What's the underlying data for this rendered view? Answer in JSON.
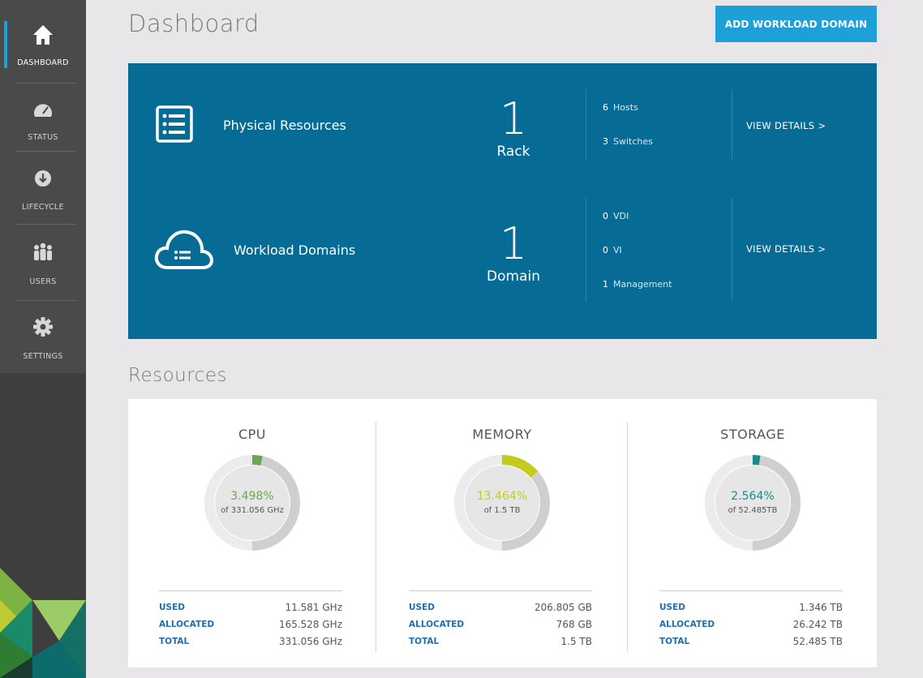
{
  "sidebar": {
    "items": [
      {
        "label": "DASHBOARD",
        "icon": "home-icon",
        "active": true
      },
      {
        "label": "STATUS",
        "icon": "gauge-icon"
      },
      {
        "label": "LIFECYCLE",
        "icon": "download-icon"
      },
      {
        "label": "USERS",
        "icon": "users-icon"
      },
      {
        "label": "SETTINGS",
        "icon": "gear-icon"
      }
    ]
  },
  "header": {
    "title": "Dashboard",
    "add_button": "ADD WORKLOAD DOMAIN"
  },
  "physical": {
    "title": "Physical Resources",
    "count": "1",
    "unit": "Rack",
    "stats": [
      {
        "num": "6",
        "label": "Hosts"
      },
      {
        "num": "3",
        "label": "Switches"
      }
    ],
    "view": "VIEW DETAILS  >"
  },
  "workload": {
    "title": "Workload Domains",
    "count": "1",
    "unit": "Domain",
    "stats": [
      {
        "num": "0",
        "label": "VDI"
      },
      {
        "num": "0",
        "label": "VI"
      },
      {
        "num": "1",
        "label": "Management"
      }
    ],
    "view": "VIEW DETAILS  >"
  },
  "resources": {
    "title": "Resources",
    "cards": [
      {
        "title": "CPU",
        "pct": "3.498%",
        "of": "of 331.056 GHz",
        "fraction": 0.035,
        "color": "#6aa84f",
        "rows": [
          {
            "k": "USED",
            "v": "11.581 GHz"
          },
          {
            "k": "ALLOCATED",
            "v": "165.528 GHz"
          },
          {
            "k": "TOTAL",
            "v": "331.056 GHz"
          }
        ]
      },
      {
        "title": "MEMORY",
        "pct": "13.464%",
        "of": "of 1.5 TB",
        "fraction": 0.135,
        "color": "#c3cc1e",
        "rows": [
          {
            "k": "USED",
            "v": "206.805 GB"
          },
          {
            "k": "ALLOCATED",
            "v": "768 GB"
          },
          {
            "k": "TOTAL",
            "v": "1.5 TB"
          }
        ]
      },
      {
        "title": "STORAGE",
        "pct": "2.564%",
        "of": "of 52.485TB",
        "fraction": 0.026,
        "color": "#1a8a8a",
        "rows": [
          {
            "k": "USED",
            "v": "1.346 TB"
          },
          {
            "k": "ALLOCATED",
            "v": "26.242 TB"
          },
          {
            "k": "TOTAL",
            "v": "52.485 TB"
          }
        ]
      }
    ]
  },
  "colors": {
    "accent": "#1d9fd8",
    "panel": "#066c96",
    "sidebar": "#4a4a4a"
  }
}
